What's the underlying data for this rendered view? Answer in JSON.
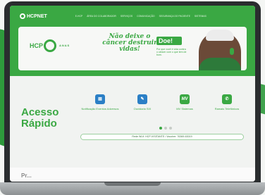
{
  "header": {
    "logo_text": "HCPNET",
    "nav": [
      "E-HCP",
      "ÁREA DO COLABORADOR",
      "SERVIÇOS",
      "COMUNICAÇÃO",
      "SEGURANÇA DO PACIENTE",
      "SISTEMAS"
    ],
    "nav_chevron_icon": "chevron-down-icon"
  },
  "banner": {
    "logo": "HCP",
    "logo_sub": "A N A S",
    "slogan": "Não deixe o câncer destruir vidas!",
    "cta_title": "Doe!",
    "cta_text": "Por que você é vida contra o câncer com o que tem de bom.",
    "accent_color": "#3aa843"
  },
  "quick_access": {
    "title": "Acesso Rápido",
    "items": [
      {
        "label": "Notificação Eventos Adversos",
        "icon": "form-icon",
        "color": "#2b7fc6"
      },
      {
        "label": "Ouvidoria SIX",
        "icon": "chat-icon",
        "color": "#2b7fc6"
      },
      {
        "label": "MV Sistemas",
        "icon": "mv-logo-icon",
        "color": "#3aa843"
      },
      {
        "label": "Ramais Telefônicos",
        "icon": "phone-icon",
        "color": "#3aa843"
      }
    ],
    "carousel_pages": 3,
    "carousel_active": 1
  },
  "wifi_info": "Rede Wi-fi: HCP-VISITANTE / Voucher: 76369-63019",
  "next_section_heading_partial": "Pr..."
}
